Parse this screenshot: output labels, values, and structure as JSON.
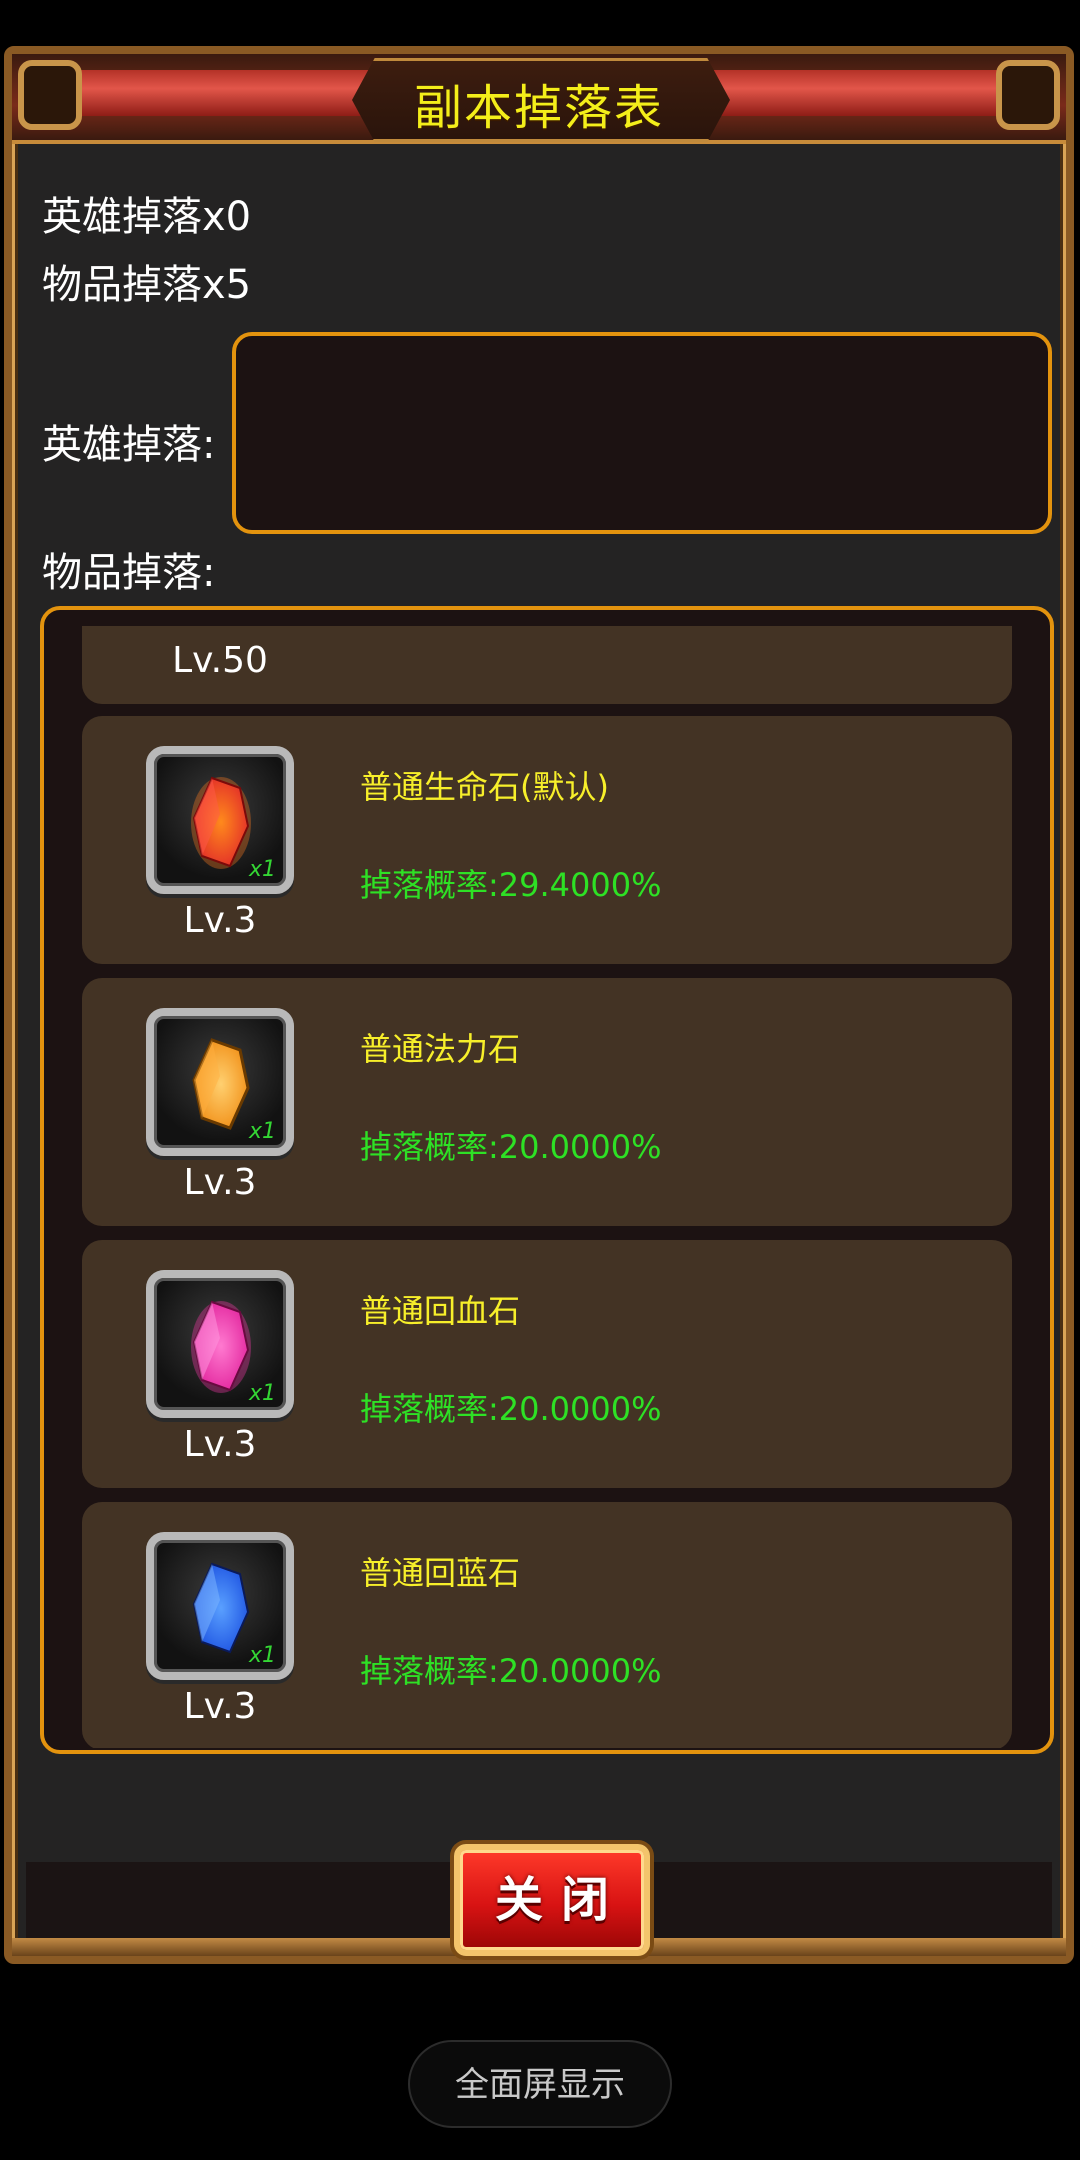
{
  "dialog": {
    "title": "副本掉落表",
    "hero_drop_count": "英雄掉落x0",
    "item_drop_count": "物品掉落x5",
    "hero_drop_label": "英雄掉落:",
    "item_drop_label": "物品掉落:",
    "close_label": "关闭"
  },
  "items": [
    {
      "level": "Lv.50",
      "name": "",
      "rate": "",
      "partial": true
    },
    {
      "level": "Lv.3",
      "name": "普通生命石(默认)",
      "rate": "掉落概率:29.4000%",
      "qty": "x1",
      "gem_color": "#e0262a",
      "gem_glow": "#ff8a1c"
    },
    {
      "level": "Lv.3",
      "name": "普通法力石",
      "rate": "掉落概率:20.0000%",
      "qty": "x1",
      "gem_color": "#f08a10",
      "gem_glow": "#ffd070"
    },
    {
      "level": "Lv.3",
      "name": "普通回血石",
      "rate": "掉落概率:20.0000%",
      "qty": "x1",
      "gem_color": "#e0209a",
      "gem_glow": "#ff7ad0"
    },
    {
      "level": "Lv.3",
      "name": "普通回蓝石",
      "rate": "掉落概率:20.0000%",
      "qty": "x1",
      "gem_color": "#1a4fe0",
      "gem_glow": "#5aa0ff"
    }
  ],
  "system": {
    "fullscreen_label": "全面屏显示"
  },
  "colors": {
    "title": "#f4ee1a",
    "item_name": "#f7ef2a",
    "rate": "#2ee125",
    "accent_border": "#e3930e",
    "card_bg": "#433324"
  }
}
